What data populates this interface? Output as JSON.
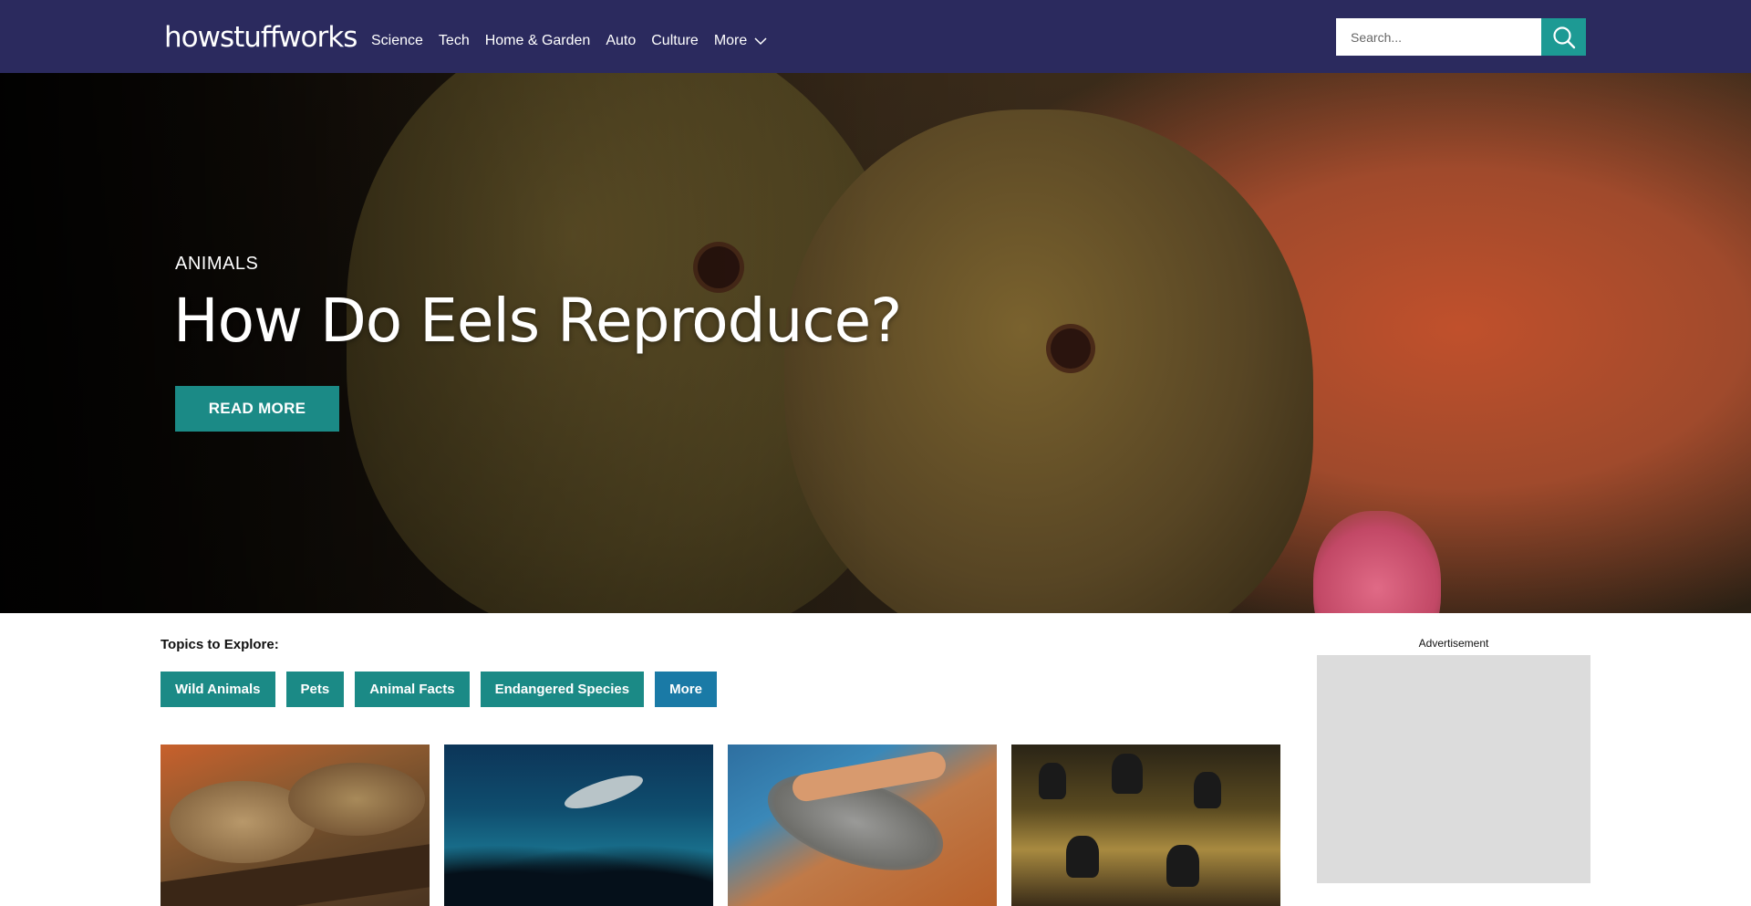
{
  "header": {
    "logo": "howstuffworks",
    "nav": [
      "Science",
      "Tech",
      "Home & Garden",
      "Auto",
      "Culture"
    ],
    "more_label": "More",
    "search_placeholder": "Search..."
  },
  "hero": {
    "category": "ANIMALS",
    "title": "How Do Eels Reproduce?",
    "button": "READ MORE"
  },
  "topics": {
    "label": "Topics to Explore:",
    "chips": [
      "Wild Animals",
      "Pets",
      "Animal Facts",
      "Endangered Species",
      "More"
    ]
  },
  "ad": {
    "label": "Advertisement"
  },
  "colors": {
    "header_bg": "#2b2a5e",
    "accent_teal": "#1b8a86",
    "search_button": "#1d9a94",
    "more_chip": "#1a7aa6",
    "ad_placeholder": "#dcdcdc"
  },
  "icons": [
    "search-icon",
    "chevron-down-icon"
  ]
}
